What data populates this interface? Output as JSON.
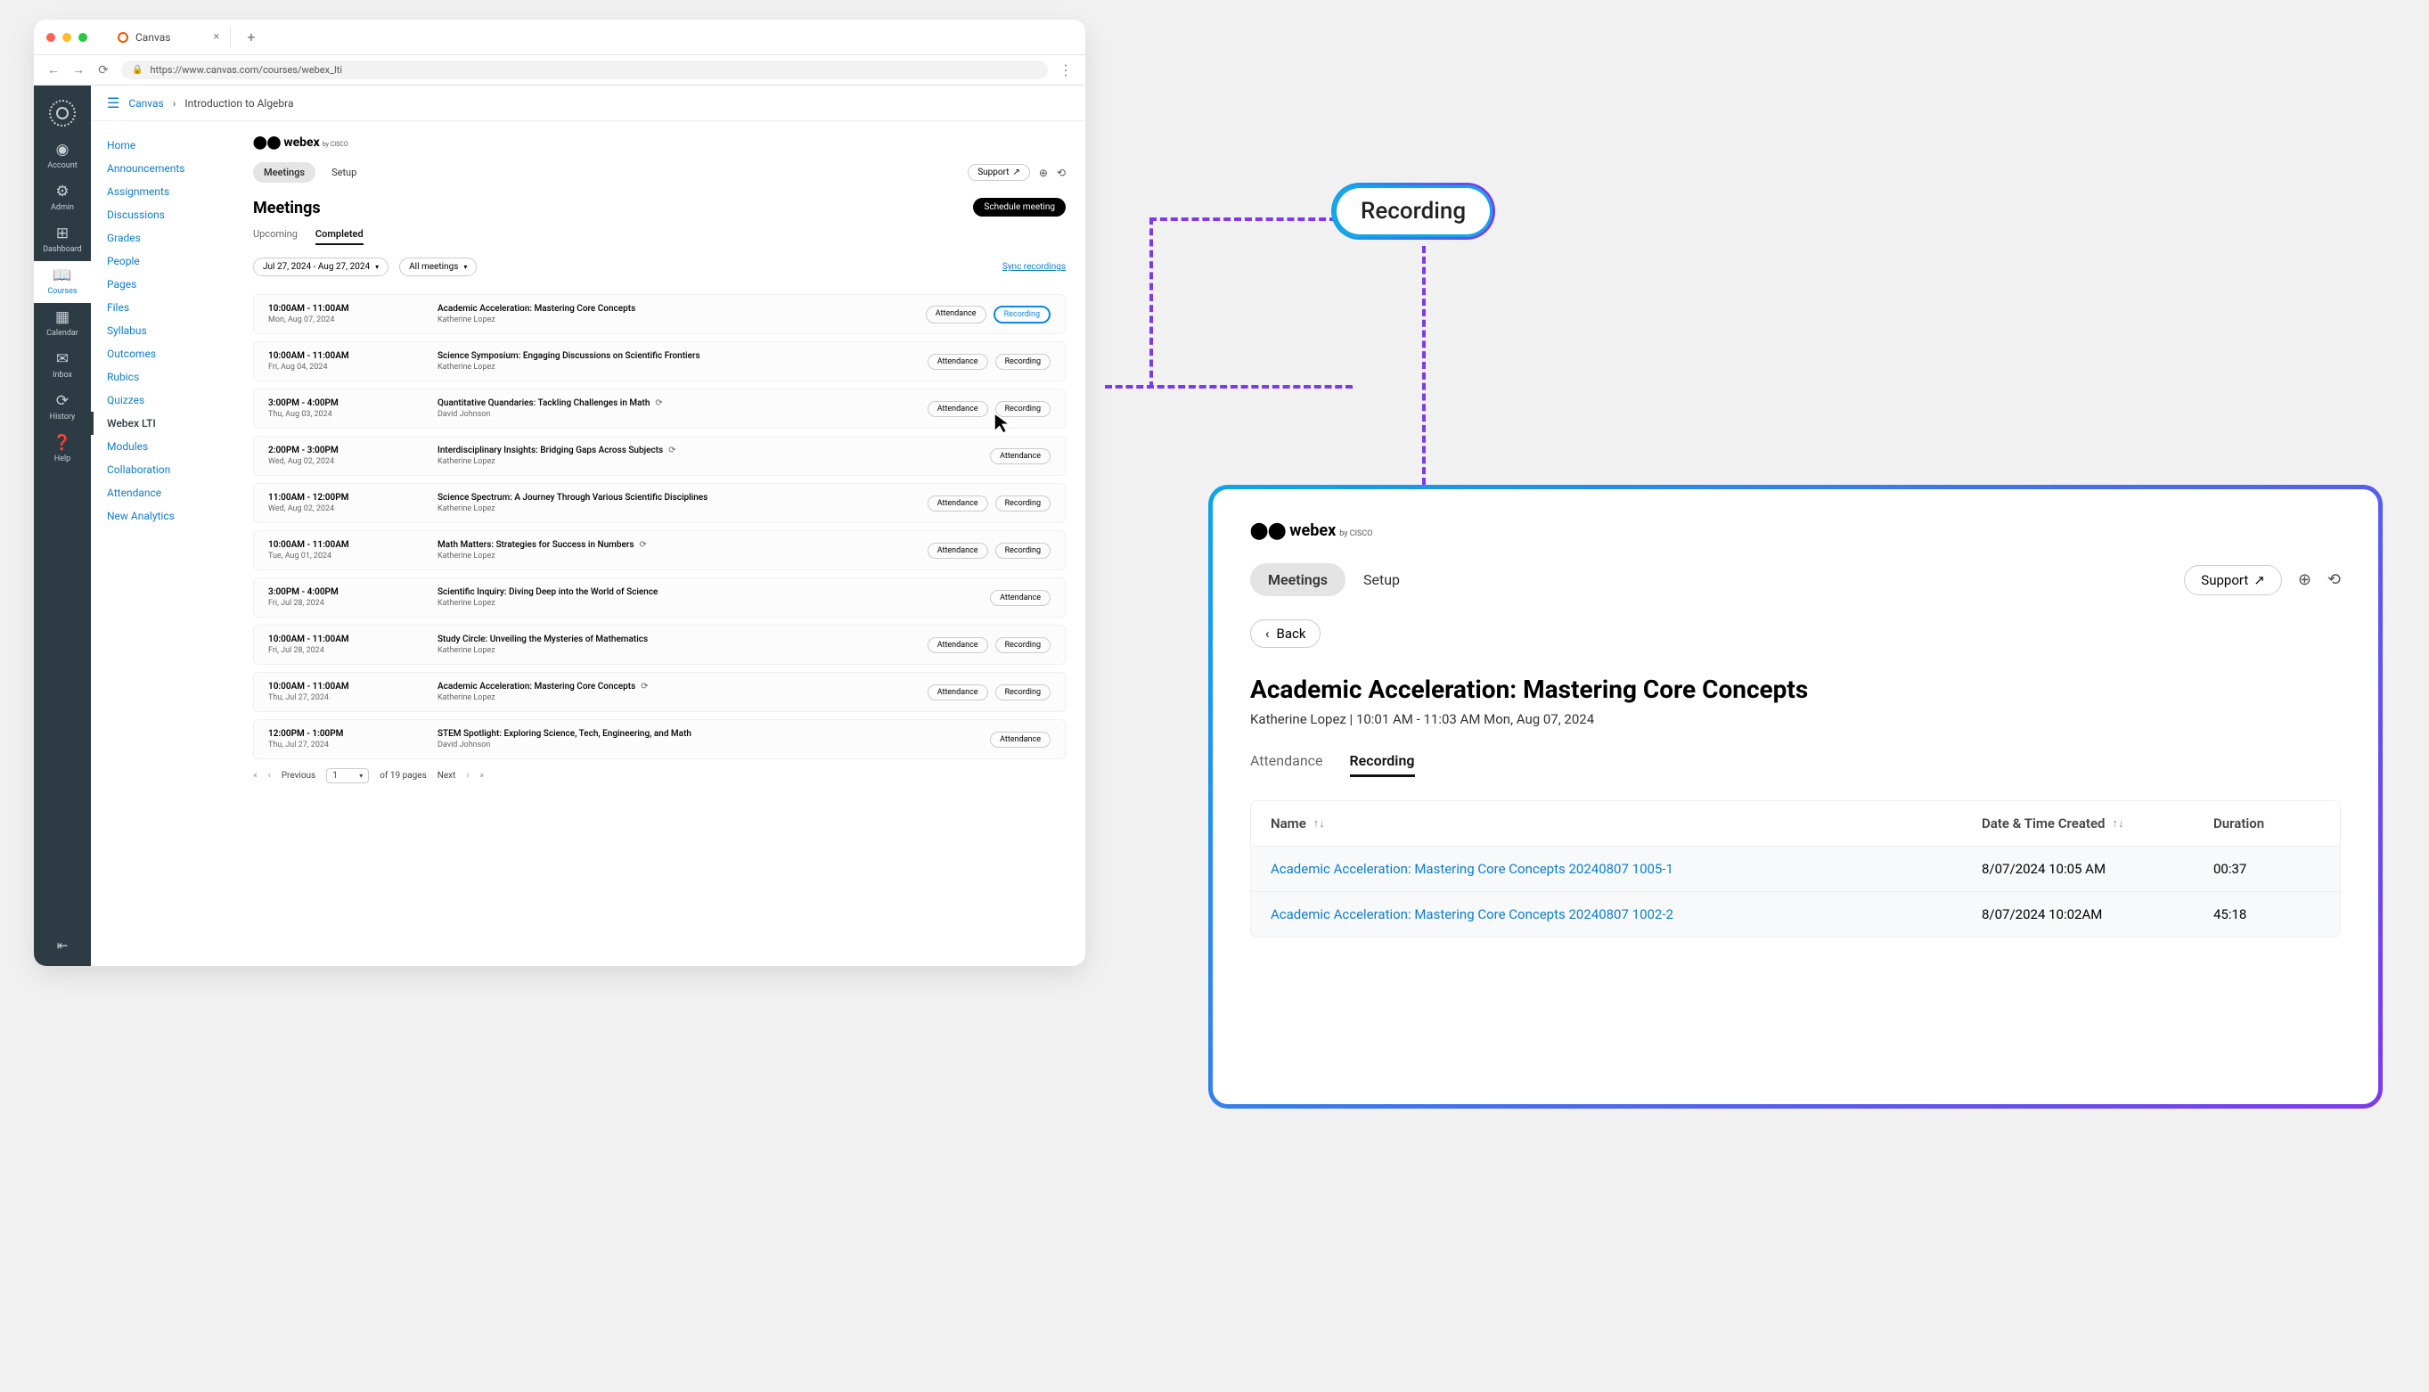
{
  "browser": {
    "tab_title": "Canvas",
    "url": "https://www.canvas.com/courses/webex_lti"
  },
  "globalnav": [
    {
      "icon": "◉",
      "label": "Account"
    },
    {
      "icon": "⚙",
      "label": "Admin"
    },
    {
      "icon": "⊞",
      "label": "Dashboard"
    },
    {
      "icon": "📖",
      "label": "Courses",
      "active": true
    },
    {
      "icon": "▦",
      "label": "Calendar"
    },
    {
      "icon": "✉",
      "label": "Inbox"
    },
    {
      "icon": "⟳",
      "label": "History"
    },
    {
      "icon": "❓",
      "label": "Help",
      "help": true
    }
  ],
  "breadcrumbs": {
    "link": "Canvas",
    "sep": "›",
    "current": "Introduction to Algebra"
  },
  "coursemenu": {
    "items": [
      {
        "label": "Home"
      },
      {
        "label": "Announcements"
      },
      {
        "label": "Assignments"
      },
      {
        "label": "Discussions"
      },
      {
        "label": "Grades"
      },
      {
        "label": "People"
      },
      {
        "label": "Pages"
      },
      {
        "label": "Files"
      },
      {
        "label": "Syllabus"
      },
      {
        "label": "Outcomes"
      },
      {
        "label": "Rubics"
      },
      {
        "label": "Quizzes"
      },
      {
        "label": "Webex LTI",
        "active": true
      },
      {
        "label": "Modules"
      },
      {
        "label": "Collaboration"
      },
      {
        "label": "Attendance"
      },
      {
        "label": "New Analytics"
      }
    ]
  },
  "webex": {
    "logo": "webex",
    "logo_sub": "by CISCO",
    "tabs": {
      "meetings": "Meetings",
      "setup": "Setup"
    },
    "support": "Support"
  },
  "meetings": {
    "heading": "Meetings",
    "schedule": "Schedule meeting",
    "subtabs": {
      "upcoming": "Upcoming",
      "completed": "Completed"
    },
    "filters": {
      "daterange": "Jul 27, 2024 - Aug 27, 2024",
      "scope": "All meetings"
    },
    "sync": "Sync recordings",
    "actions": {
      "attendance": "Attendance",
      "recording": "Recording"
    },
    "rows": [
      {
        "time": "10:00AM - 11:00AM",
        "date": "Mon, Aug 07, 2024",
        "title": "Academic Acceleration: Mastering Core Concepts",
        "author": "Katherine Lopez",
        "recur": false,
        "att": true,
        "rec": true,
        "rec_hl": true
      },
      {
        "time": "10:00AM - 11:00AM",
        "date": "Fri, Aug 04, 2024",
        "title": "Science Symposium: Engaging Discussions on Scientific Frontiers",
        "author": "Katherine Lopez",
        "recur": false,
        "att": true,
        "rec": true
      },
      {
        "time": "3:00PM - 4:00PM",
        "date": "Thu, Aug 03, 2024",
        "title": "Quantitative Quandaries: Tackling Challenges in Math",
        "author": "David Johnson",
        "recur": true,
        "att": true,
        "rec": true
      },
      {
        "time": "2:00PM - 3:00PM",
        "date": "Wed, Aug 02, 2024",
        "title": "Interdisciplinary Insights: Bridging Gaps Across Subjects",
        "author": "Katherine Lopez",
        "recur": true,
        "att": true,
        "rec": false
      },
      {
        "time": "11:00AM - 12:00PM",
        "date": "Wed, Aug 02, 2024",
        "title": "Science Spectrum: A Journey Through Various Scientific Disciplines",
        "author": "Katherine Lopez",
        "recur": false,
        "att": true,
        "rec": true
      },
      {
        "time": "10:00AM - 11:00AM",
        "date": "Tue, Aug 01, 2024",
        "title": "Math Matters: Strategies for Success in Numbers",
        "author": "Katherine Lopez",
        "recur": true,
        "att": true,
        "rec": true
      },
      {
        "time": "3:00PM - 4:00PM",
        "date": "Fri, Jul 28, 2024",
        "title": "Scientific Inquiry: Diving Deep into the World of Science",
        "author": "Katherine Lopez",
        "recur": false,
        "att": true,
        "rec": false
      },
      {
        "time": "10:00AM - 11:00AM",
        "date": "Fri, Jul 28, 2024",
        "title": "Study Circle: Unveiling the Mysteries of Mathematics",
        "author": "Katherine Lopez",
        "recur": false,
        "att": true,
        "rec": true
      },
      {
        "time": "10:00AM - 11:00AM",
        "date": "Thu, Jul 27, 2024",
        "title": "Academic Acceleration: Mastering Core Concepts",
        "author": "Katherine Lopez",
        "recur": true,
        "att": true,
        "rec": true
      },
      {
        "time": "12:00PM - 1:00PM",
        "date": "Thu, Jul 27, 2024",
        "title": "STEM Spotlight: Exploring Science, Tech, Engineering, and Math",
        "author": "David Johnson",
        "recur": false,
        "att": true,
        "rec": false
      }
    ],
    "pager": {
      "prev": "Previous",
      "page": "1",
      "of": "of 19 pages",
      "next": "Next"
    }
  },
  "callout": {
    "label": "Recording"
  },
  "detail": {
    "logo": "webex",
    "logo_sub": "by CISCO",
    "tabs": {
      "meetings": "Meetings",
      "setup": "Setup"
    },
    "support": "Support",
    "back": "Back",
    "title": "Academic Acceleration: Mastering Core Concepts",
    "subtitle": "Katherine Lopez | 10:01 AM - 11:03 AM Mon, Aug 07, 2024",
    "subtabs": {
      "attendance": "Attendance",
      "recording": "Recording"
    },
    "table": {
      "headers": {
        "name": "Name",
        "date": "Date & Time Created",
        "duration": "Duration"
      },
      "rows": [
        {
          "name": "Academic Acceleration: Mastering Core Concepts 20240807 1005-1",
          "date": "8/07/2024 10:05 AM",
          "duration": "00:37"
        },
        {
          "name": "Academic Acceleration: Mastering Core Concepts 20240807 1002-2",
          "date": "8/07/2024 10:02AM",
          "duration": "45:18"
        }
      ]
    }
  }
}
